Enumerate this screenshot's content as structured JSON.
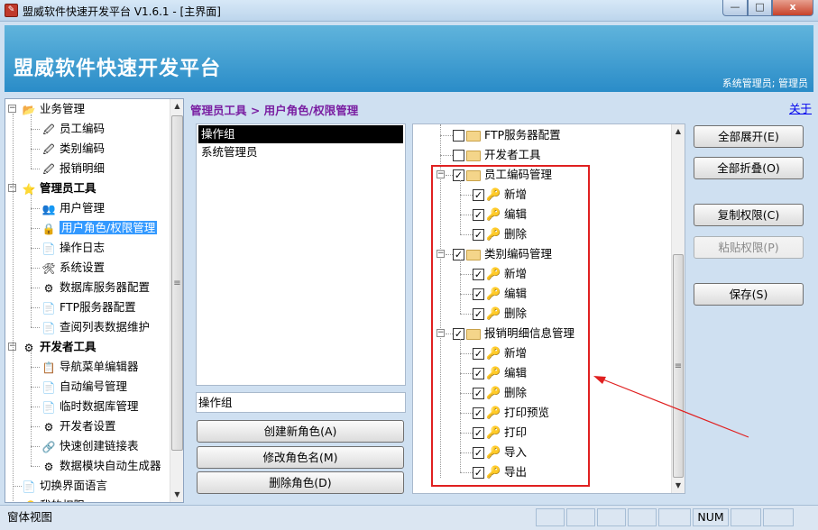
{
  "window": {
    "title": "盟威软件快速开发平台 V1.6.1 - [主界面]",
    "min_glyph": "—",
    "max_glyph": "□",
    "close_glyph": "x"
  },
  "header": {
    "app_title": "盟威软件快速开发平台",
    "user": "系统管理员; 管理员"
  },
  "sidebar": {
    "groups": [
      {
        "label": "业务管理",
        "expander": "−",
        "items": [
          "员工编码",
          "类别编码",
          "报销明细"
        ]
      },
      {
        "label": "管理员工具",
        "expander": "−",
        "items": [
          "用户管理",
          "用户角色/权限管理",
          "操作日志",
          "系统设置",
          "数据库服务器配置",
          "FTP服务器配置",
          "查阅列表数据维护"
        ]
      },
      {
        "label": "开发者工具",
        "expander": "−",
        "items": [
          "导航菜单编辑器",
          "自动编号管理",
          "临时数据库管理",
          "开发者设置",
          "快速创建链接表",
          "数据模块自动生成器"
        ]
      },
      {
        "label": "切换界面语言",
        "expander": ""
      },
      {
        "label": "我的权限",
        "expander": ""
      }
    ],
    "selected": "用户角色/权限管理"
  },
  "breadcrumb": "管理员工具 > 用户角色/权限管理",
  "about_link": "关于",
  "roles": {
    "items": [
      "操作组",
      "系统管理员"
    ],
    "selected_index": 0,
    "name_value": "操作组"
  },
  "role_buttons": {
    "create": "创建新角色(A)",
    "rename": "修改角色名(M)",
    "delete": "删除角色(D)"
  },
  "permissions": {
    "pre_items": [
      "FTP服务器配置",
      "开发者工具"
    ],
    "groups": [
      {
        "label": "员工编码管理",
        "checked": true,
        "items": [
          "新增",
          "编辑",
          "删除"
        ]
      },
      {
        "label": "类别编码管理",
        "checked": true,
        "items": [
          "新增",
          "编辑",
          "删除"
        ]
      },
      {
        "label": "报销明细信息管理",
        "checked": true,
        "items": [
          "新增",
          "编辑",
          "删除",
          "打印预览",
          "打印",
          "导入",
          "导出"
        ]
      }
    ]
  },
  "actions": {
    "expand_all": "全部展开(E)",
    "collapse_all": "全部折叠(O)",
    "copy_perm": "复制权限(C)",
    "paste_perm": "粘贴权限(P)",
    "save": "保存(S)"
  },
  "status": {
    "view": "窗体视图",
    "num": "NUM"
  },
  "colors": {
    "header_top": "#60b4dc",
    "header_bottom": "#2a8cc8",
    "breadcrumb": "#7a1fa2",
    "highlight": "#e02020",
    "selection": "#3399ff"
  }
}
